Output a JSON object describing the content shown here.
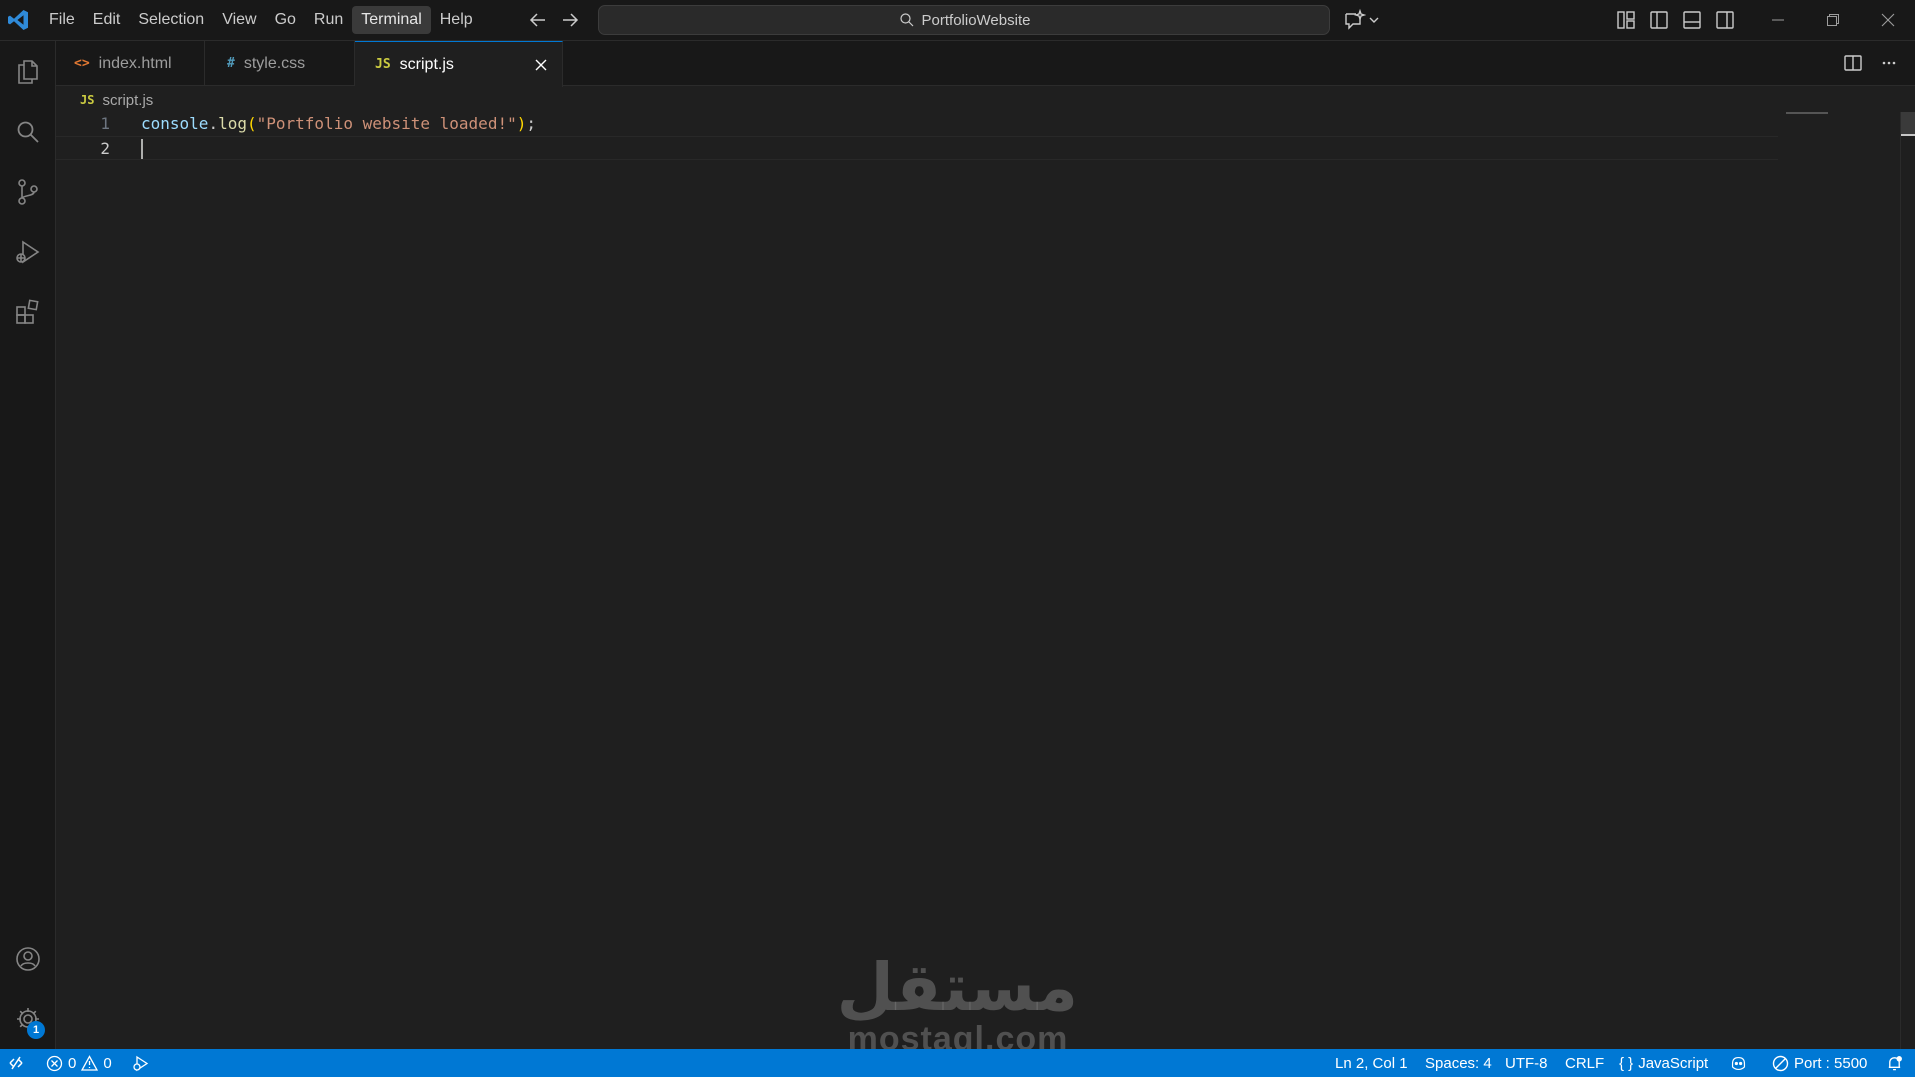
{
  "titlebar": {
    "menu": [
      "File",
      "Edit",
      "Selection",
      "View",
      "Go",
      "Run",
      "Terminal",
      "Help"
    ],
    "active_menu": "Terminal",
    "search_text": "PortfolioWebsite"
  },
  "tabs": [
    {
      "icon": "<>",
      "label": "index.html"
    },
    {
      "icon": "#",
      "label": "style.css"
    },
    {
      "icon": "JS",
      "label": "script.js"
    }
  ],
  "breadcrumb": {
    "icon": "JS",
    "file": "script.js"
  },
  "editor": {
    "line_numbers": [
      "1",
      "2"
    ],
    "line1": {
      "obj": "console",
      "dot": ".",
      "fn": "log",
      "open": "(",
      "str": "\"Portfolio website loaded!\"",
      "close": ")",
      "semi": ";"
    }
  },
  "watermark": {
    "arabic": "مستقل",
    "latin": "mostaql.com"
  },
  "statusbar": {
    "errors": "0",
    "warnings": "0",
    "position": "Ln 2, Col 1",
    "spaces": "Spaces: 4",
    "encoding": "UTF-8",
    "eol": "CRLF",
    "language_brace": "{ }",
    "language": "JavaScript",
    "port": "Port : 5500"
  },
  "colors": {
    "accent": "#0078d4",
    "editor_bg": "#1f1f1f",
    "chrome_bg": "#181818"
  }
}
